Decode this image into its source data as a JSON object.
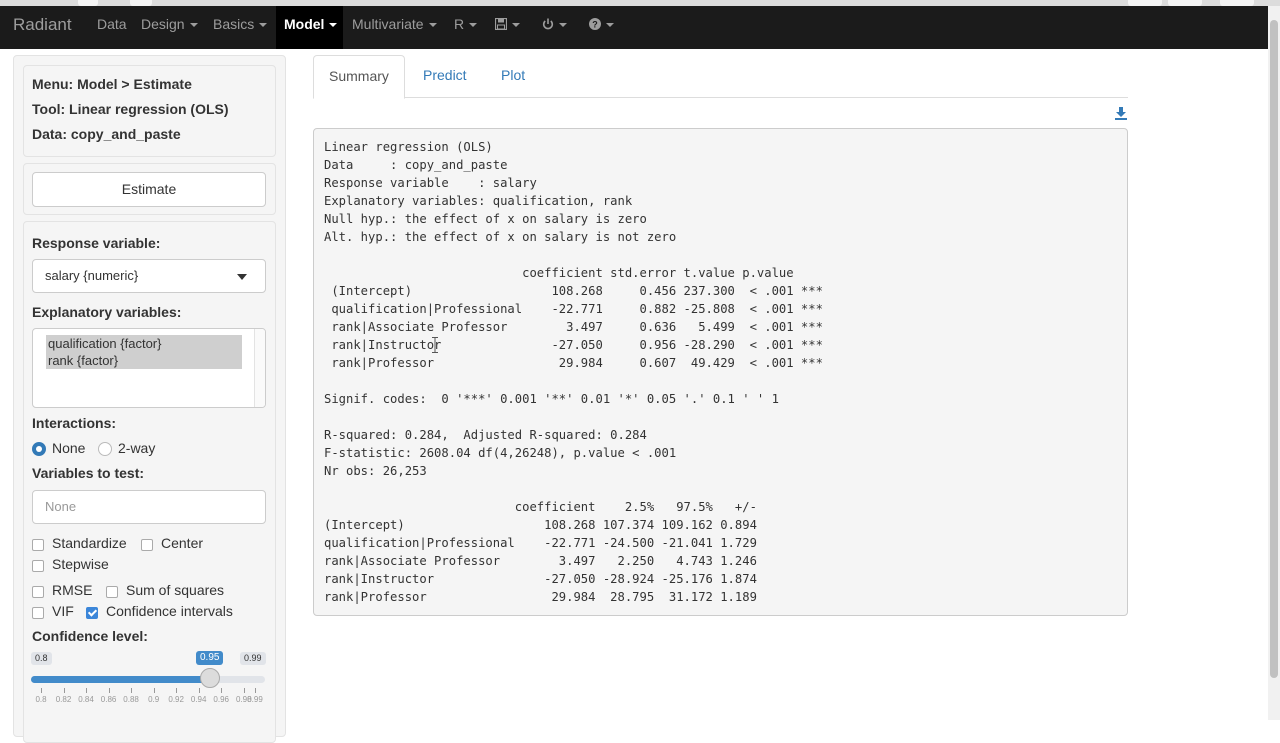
{
  "navbar": {
    "brand": "Radiant",
    "items": [
      {
        "label": "Data",
        "caret": false
      },
      {
        "label": "Design",
        "caret": true
      },
      {
        "label": "Basics",
        "caret": true
      },
      {
        "label": "Model",
        "caret": true,
        "active": true
      },
      {
        "label": "Multivariate",
        "caret": true
      },
      {
        "label": "R",
        "caret": true
      }
    ],
    "icons": [
      "save-icon",
      "power-icon",
      "help-icon"
    ]
  },
  "sidebar": {
    "menu": "Menu: Model > Estimate",
    "tool": "Tool: Linear regression (OLS)",
    "data": "Data: copy_and_paste",
    "estimate_button": "Estimate",
    "response_label": "Response variable:",
    "response_value": "salary {numeric}",
    "explanatory_label": "Explanatory variables:",
    "explanatory_options": [
      "qualification {factor}",
      "rank {factor}"
    ],
    "interactions_label": "Interactions:",
    "interactions_options": [
      "None",
      "2-way"
    ],
    "interactions_selected": "None",
    "vars_to_test_label": "Variables to test:",
    "vars_to_test_placeholder": "None",
    "checkboxes": {
      "standardize": {
        "label": "Standardize",
        "checked": false
      },
      "center": {
        "label": "Center",
        "checked": false
      },
      "stepwise": {
        "label": "Stepwise",
        "checked": false
      },
      "rmse": {
        "label": "RMSE",
        "checked": false
      },
      "sum_of_squares": {
        "label": "Sum of squares",
        "checked": false
      },
      "vif": {
        "label": "VIF",
        "checked": false
      },
      "confidence_intervals": {
        "label": "Confidence intervals",
        "checked": true
      }
    },
    "conf_level": {
      "label": "Confidence level:",
      "min": "0.8",
      "max": "0.99",
      "value": "0.95",
      "value_num": 0.95,
      "min_num": 0.8,
      "max_num": 0.99,
      "ticks": [
        "0.8",
        "0.82",
        "0.84",
        "0.86",
        "0.88",
        "0.9",
        "0.92",
        "0.94",
        "0.96",
        "0.98",
        "0.99"
      ]
    }
  },
  "main": {
    "tabs": [
      "Summary",
      "Predict",
      "Plot"
    ],
    "active_tab": "Summary",
    "output_lines": [
      "Linear regression (OLS)",
      "Data     : copy_and_paste",
      "Response variable    : salary",
      "Explanatory variables: qualification, rank",
      "Null hyp.: the effect of x on salary is zero",
      "Alt. hyp.: the effect of x on salary is not zero",
      "",
      "                           coefficient std.error t.value p.value",
      " (Intercept)                   108.268     0.456 237.300  < .001 ***",
      " qualification|Professional    -22.771     0.882 -25.808  < .001 ***",
      " rank|Associate Professor        3.497     0.636   5.499  < .001 ***",
      " rank|Instructor               -27.050     0.956 -28.290  < .001 ***",
      " rank|Professor                 29.984     0.607  49.429  < .001 ***",
      "",
      "Signif. codes:  0 '***' 0.001 '**' 0.01 '*' 0.05 '.' 0.1 ' ' 1",
      "",
      "R-squared: 0.284,  Adjusted R-squared: 0.284",
      "F-statistic: 2608.04 df(4,26248), p.value < .001",
      "Nr obs: 26,253",
      "",
      "                          coefficient    2.5%   97.5%   +/-",
      "(Intercept)                   108.268 107.374 109.162 0.894",
      "qualification|Professional    -22.771 -24.500 -21.041 1.729",
      "rank|Associate Professor        3.497   2.250   4.743 1.246",
      "rank|Instructor               -27.050 -28.924 -25.176 1.874",
      "rank|Professor                 29.984  28.795  31.172 1.189"
    ]
  }
}
